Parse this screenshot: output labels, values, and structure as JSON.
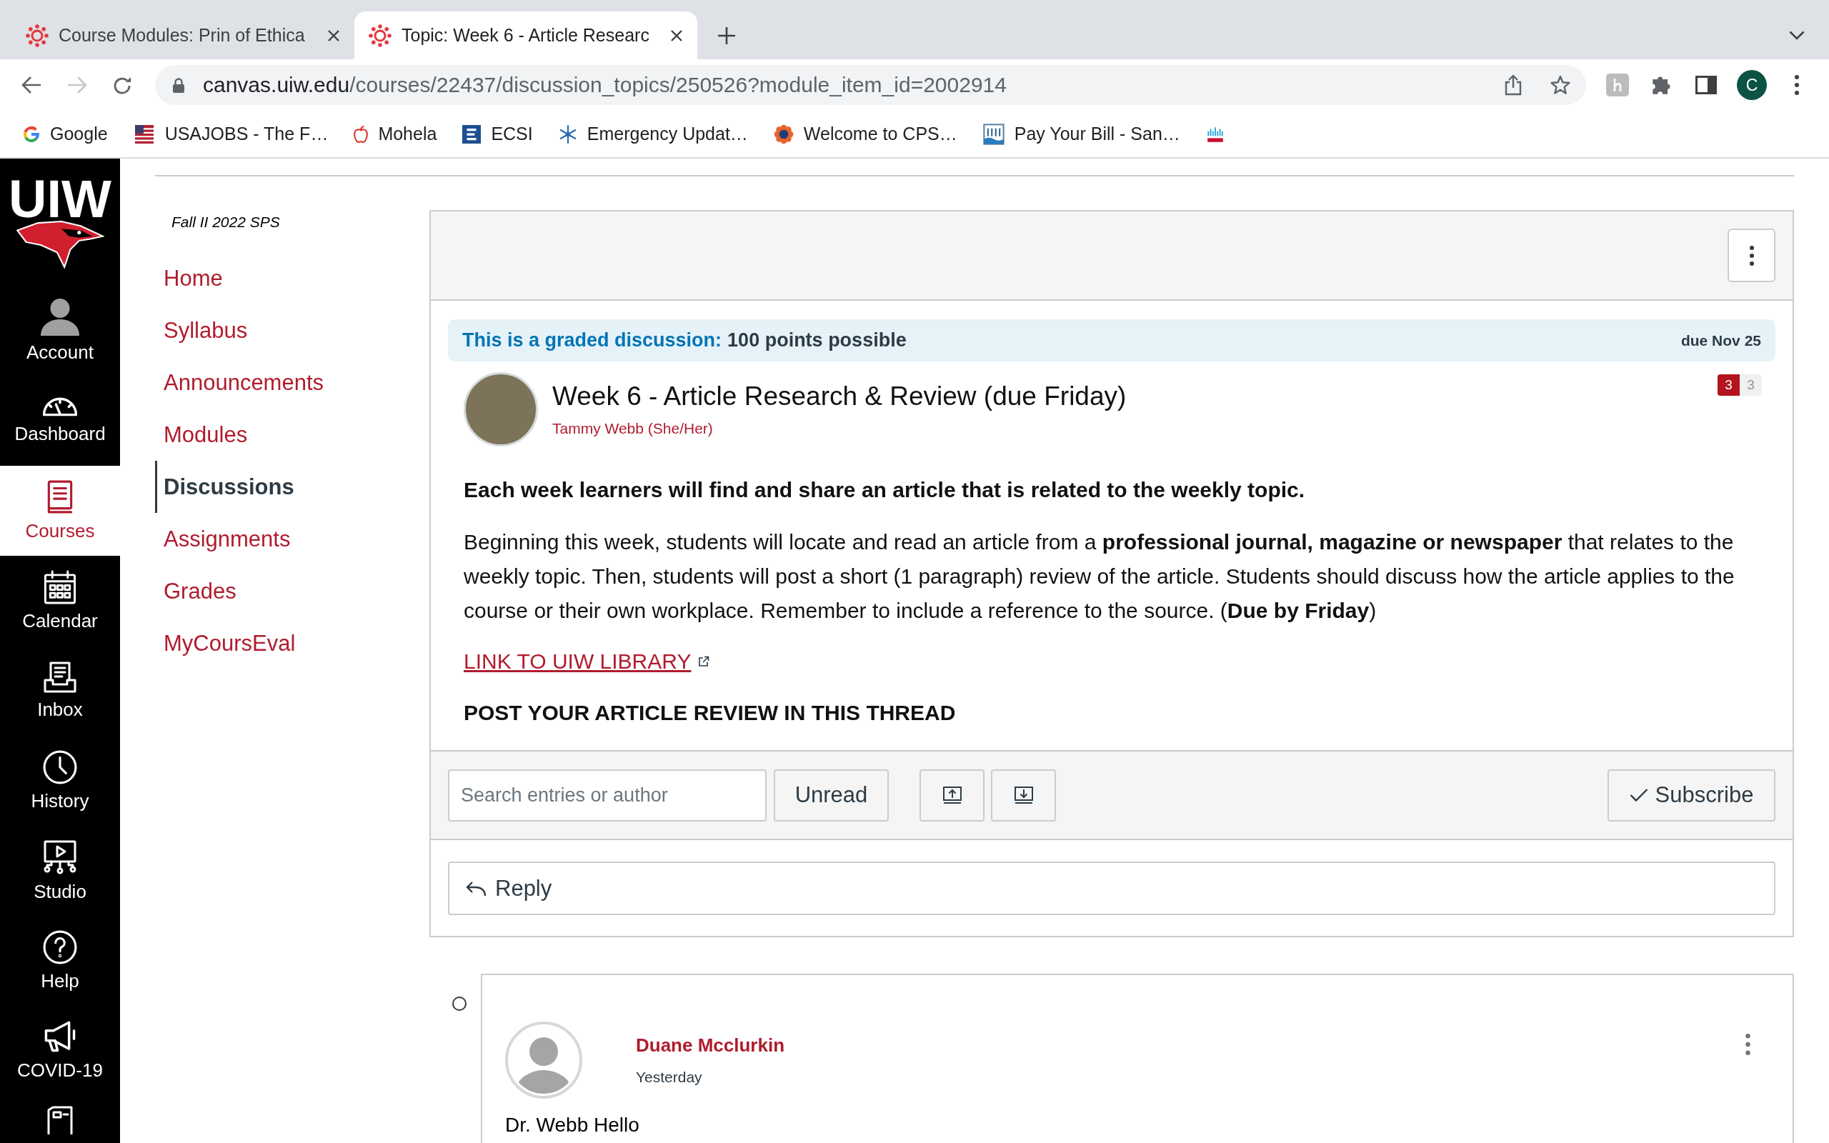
{
  "browser": {
    "tabs": [
      {
        "title": "Course Modules: Prin of Ethica",
        "selected": false
      },
      {
        "title": "Topic: Week 6 - Article Researc",
        "selected": true
      }
    ],
    "can_go_forward": false,
    "address": {
      "host": "canvas.uiw.edu",
      "path": "/courses/22437/discussion_topics/250526?module_item_id=2002914"
    },
    "profile_initial": "C",
    "bookmarks": [
      {
        "label": "Google"
      },
      {
        "label": "USAJOBS - The F…"
      },
      {
        "label": "Mohela"
      },
      {
        "label": "ECSI"
      },
      {
        "label": "Emergency Updat…"
      },
      {
        "label": "Welcome to CPS…"
      },
      {
        "label": "Pay Your Bill - San…"
      }
    ]
  },
  "global_nav": {
    "logo": "UIW",
    "items": [
      {
        "label": "Account",
        "selected": false
      },
      {
        "label": "Dashboard",
        "selected": false
      },
      {
        "label": "Courses",
        "selected": true
      },
      {
        "label": "Calendar",
        "selected": false
      },
      {
        "label": "Inbox",
        "selected": false
      },
      {
        "label": "History",
        "selected": false
      },
      {
        "label": "Studio",
        "selected": false
      },
      {
        "label": "Help",
        "selected": false
      },
      {
        "label": "COVID-19",
        "selected": false
      }
    ]
  },
  "course_nav": {
    "term": "Fall II 2022 SPS",
    "items": [
      {
        "label": "Home",
        "selected": false
      },
      {
        "label": "Syllabus",
        "selected": false
      },
      {
        "label": "Announcements",
        "selected": false
      },
      {
        "label": "Modules",
        "selected": false
      },
      {
        "label": "Discussions",
        "selected": true
      },
      {
        "label": "Assignments",
        "selected": false
      },
      {
        "label": "Grades",
        "selected": false
      },
      {
        "label": "MyCoursEval",
        "selected": false
      }
    ]
  },
  "discussion": {
    "graded_label": "This is a graded discussion:",
    "points": "100 points possible",
    "due": "due Nov 25",
    "title": "Week 6 - Article Research & Review (due Friday)",
    "author": "Tammy Webb (She/Her)",
    "unread_count": "3",
    "reply_count": "3",
    "intro": "Each week learners will find and share an article that is related to the weekly topic.",
    "body": "Beginning this week, students will locate and read an article from a **professional journal, magazine or newspaper** that relates to the weekly topic. Then, students will post a short (1 paragraph) review of the article. Students should discuss how the article applies to the course or their own workplace. Remember to include a reference to the source. (**Due by Friday**)",
    "link": "LINK TO UIW LIBRARY",
    "instruction": "POST YOUR ARTICLE REVIEW IN THIS THREAD"
  },
  "toolbar": {
    "search": {
      "placeholder": "Search entries or author"
    },
    "filter": "Unread",
    "subscribe": "Subscribe"
  },
  "reply": "Reply",
  "entries": [
    {
      "author": "Duane Mcclurkin",
      "time": "Yesterday",
      "message": "Dr. Webb Hello",
      "read": true
    }
  ]
}
